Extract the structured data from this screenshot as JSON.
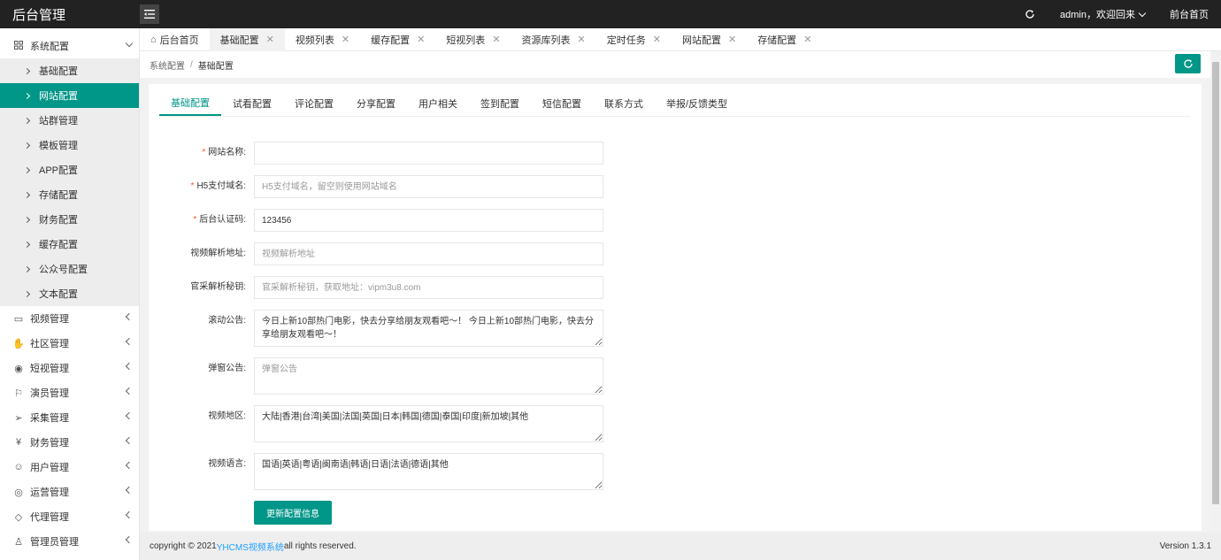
{
  "header": {
    "logo": "后台管理",
    "user": "admin，欢迎回来",
    "frontend": "前台首页"
  },
  "sidebar": {
    "groups": [
      {
        "label": "系统配置",
        "icon": "grid-icon",
        "expanded": true
      },
      {
        "label": "视频管理",
        "icon": "video-icon"
      },
      {
        "label": "社区管理",
        "icon": "hand-icon"
      },
      {
        "label": "短视管理",
        "icon": "play-circle-icon"
      },
      {
        "label": "演员管理",
        "icon": "flag-icon"
      },
      {
        "label": "采集管理",
        "icon": "send-icon"
      },
      {
        "label": "财务管理",
        "icon": "money-icon"
      },
      {
        "label": "用户管理",
        "icon": "user-icon"
      },
      {
        "label": "运营管理",
        "icon": "target-icon"
      },
      {
        "label": "代理管理",
        "icon": "diamond-icon"
      },
      {
        "label": "管理员管理",
        "icon": "admin-icon"
      }
    ],
    "sub_items": [
      "基础配置",
      "网站配置",
      "站群管理",
      "模板管理",
      "APP配置",
      "存储配置",
      "财务配置",
      "缓存配置",
      "公众号配置",
      "文本配置"
    ],
    "active_sub": "网站配置"
  },
  "tabs": {
    "home": "后台首页",
    "items": [
      "基础配置",
      "视频列表",
      "缓存配置",
      "短视列表",
      "资源库列表",
      "定时任务",
      "网站配置",
      "存储配置"
    ],
    "close": "✕"
  },
  "breadcrumb": {
    "parent": "系统配置",
    "sep": "/",
    "current": "基础配置"
  },
  "sub_tabs": [
    "基础配置",
    "试看配置",
    "评论配置",
    "分享配置",
    "用户相关",
    "签到配置",
    "短信配置",
    "联系方式",
    "举报/反馈类型"
  ],
  "form": {
    "site_name": {
      "label": "网站名称:",
      "required": true,
      "value": "",
      "placeholder": ""
    },
    "h5_domain": {
      "label": "H5支付域名:",
      "required": true,
      "value": "",
      "placeholder": "H5支付域名，留空则使用网站域名"
    },
    "auth_code": {
      "label": "后台认证码:",
      "required": true,
      "value": "123456",
      "placeholder": ""
    },
    "parse_url": {
      "label": "视频解析地址:",
      "required": false,
      "value": "",
      "placeholder": "视频解析地址"
    },
    "parse_key": {
      "label": "官采解析秘钥:",
      "required": false,
      "value": "",
      "placeholder": "官采解析秘钥，获取地址：vipm3u8.com"
    },
    "notice": {
      "label": "滚动公告:",
      "required": false,
      "value": "今日上新10部热门电影，快去分享给朋友观看吧～！ 今日上新10部热门电影，快去分享给朋友观看吧～！",
      "placeholder": ""
    },
    "popup": {
      "label": "弹窗公告:",
      "required": false,
      "value": "",
      "placeholder": "弹窗公告"
    },
    "regions": {
      "label": "视频地区:",
      "required": false,
      "value": "大陆|香港|台湾|美国|法国|英国|日本|韩国|德国|泰国|印度|新加坡|其他",
      "placeholder": ""
    },
    "languages": {
      "label": "视频语言:",
      "required": false,
      "value": "国语|英语|粤语|闽南语|韩语|日语|法语|德语|其他",
      "placeholder": ""
    },
    "submit": "更新配置信息",
    "required_mark": "*"
  },
  "footer": {
    "copyright_prefix": "copyright © 2021 ",
    "brand": "YHCMS视频系统",
    "copyright_suffix": " all rights reserved.",
    "version": "Version 1.3.1"
  },
  "colors": {
    "accent": "#009688",
    "header_bg": "#222222",
    "required": "#ff5722",
    "link": "#1e9fff"
  }
}
